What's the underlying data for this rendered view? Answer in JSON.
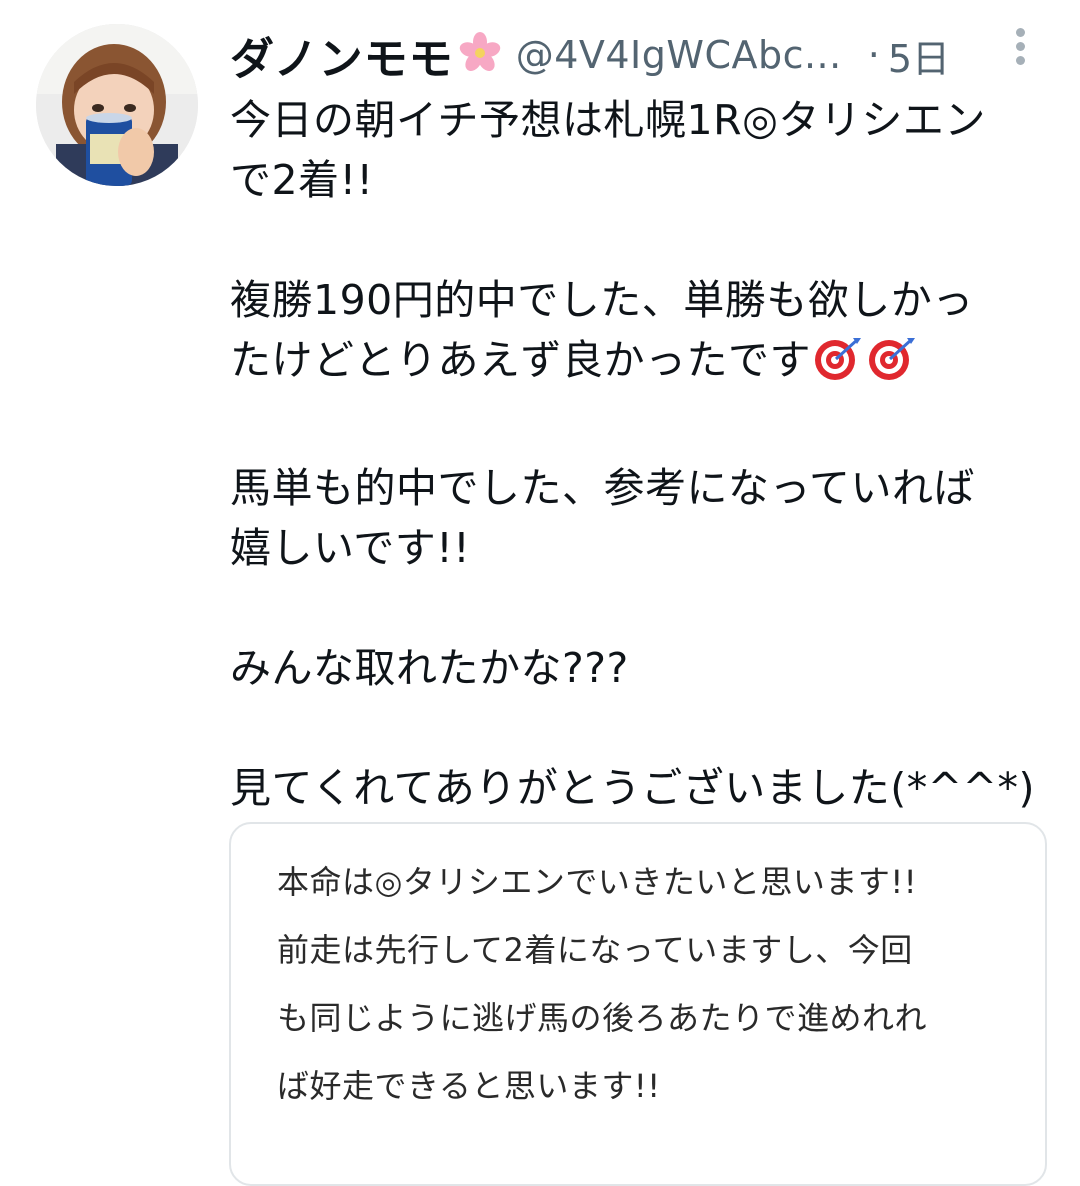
{
  "post": {
    "author": {
      "display_name": "ダノンモモ",
      "name_emoji": "cherry-blossom-icon",
      "handle": "@4V4IgWCAbc...",
      "separator": "·",
      "time": "5日"
    },
    "menu_icon": "more-vertical-icon",
    "body": {
      "line1": "今日の朝イチ予想は札幌1R◎タリシエン",
      "line2": "で2着!!",
      "line3": "複勝190円的中でした、単勝も欲しかっ",
      "line4": "たけどとりあえず良かったです",
      "line4_emoji": "direct-hit-icon",
      "line5": "馬単も的中でした、参考になっていれば",
      "line6": "嬉しいです!!",
      "line7": "みんな取れたかな???",
      "line8": "見てくれてありがとうございました(*^^*)"
    },
    "quoted_image": {
      "line1": "本命は◎タリシエンでいきたいと思います!!",
      "line2": "前走は先行して2着になっていますし、今回",
      "line3": "も同じように逃げ馬の後ろあたりで進めれれ",
      "line4": "ば好走できると思います!!"
    }
  },
  "colors": {
    "text_primary": "#0f1419",
    "text_secondary": "#536471",
    "card_border": "#e1e5e8"
  }
}
